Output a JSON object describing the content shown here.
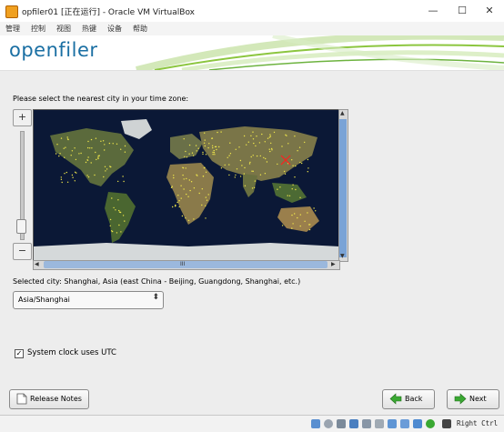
{
  "window": {
    "title": "opfiler01 [正在运行] - Oracle VM VirtualBox",
    "minimize": "—",
    "maximize": "☐",
    "close": "✕"
  },
  "menu": [
    "管理",
    "控制",
    "视图",
    "热键",
    "设备",
    "帮助"
  ],
  "banner": {
    "logo": "openfiler"
  },
  "timezone": {
    "prompt": "Please select the nearest city in your time zone:",
    "selected_city": "Selected city: Shanghai, Asia (east China - Beijing, Guangdong, Shanghai, etc.)",
    "dropdown_value": "Asia/Shanghai",
    "zoom_in": "+",
    "zoom_out": "−",
    "scroll_label": "III"
  },
  "utc": {
    "label": "System clock uses UTC",
    "checked": true
  },
  "buttons": {
    "release_notes": "Release Notes",
    "back": "Back",
    "next": "Next"
  },
  "status": {
    "host_key": "Right Ctrl"
  },
  "colors": {
    "logo": "#1a6fa3",
    "ocean": "#0a1530",
    "scroll_accent": "#7aa3d6",
    "arrow_green": "#3aa832"
  }
}
